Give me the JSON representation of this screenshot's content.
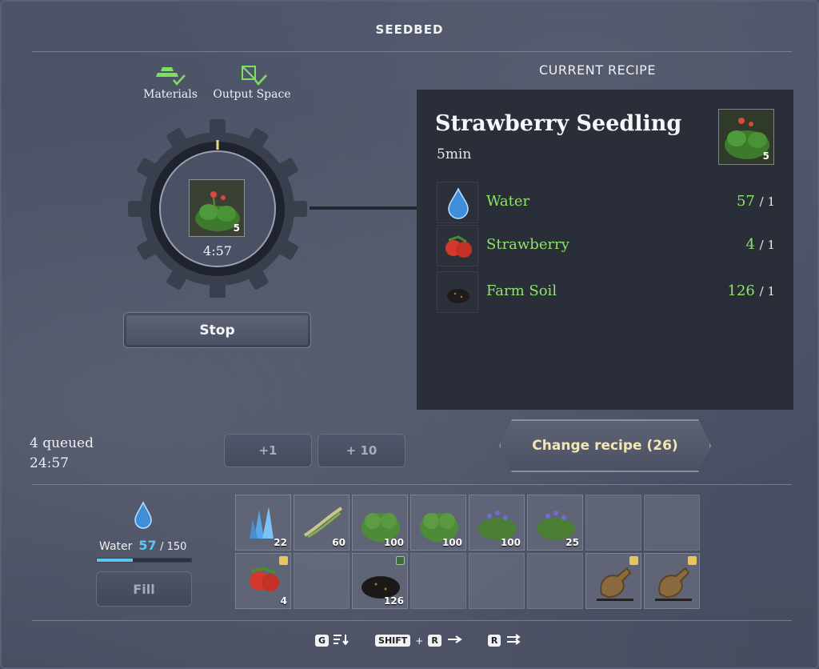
{
  "window": {
    "title": "SEEDBED"
  },
  "status": {
    "materials_label": "Materials",
    "output_label": "Output Space",
    "ok_color": "#7ee061"
  },
  "crafting": {
    "item_count": "5",
    "time_remaining": "4:57",
    "progress": 0.01,
    "stop_label": "Stop"
  },
  "recipe": {
    "header": "CURRENT RECIPE",
    "name": "Strawberry Seedling",
    "duration": "5min",
    "output_count": "5",
    "ingredients": [
      {
        "name": "Water",
        "have": "57",
        "need": "/ 1",
        "icon": "water-drop-icon"
      },
      {
        "name": "Strawberry",
        "have": "4",
        "need": "/ 1",
        "icon": "strawberry-icon"
      },
      {
        "name": "Farm Soil",
        "have": "126",
        "need": "/ 1",
        "icon": "farm-soil-icon"
      }
    ]
  },
  "queue": {
    "count_text": "4 queued",
    "total_time": "24:57",
    "plus1_label": "+1",
    "plus10_label": "+ 10",
    "change_label": "Change recipe (26)"
  },
  "water": {
    "label": "Water",
    "current": "57",
    "max": "/ 150",
    "fill_fraction": 0.38,
    "fill_label": "Fill"
  },
  "inventory": {
    "row1": [
      {
        "icon": "crystal-icon",
        "count": "22"
      },
      {
        "icon": "fiber-icon",
        "count": "60"
      },
      {
        "icon": "shrub-icon",
        "count": "100"
      },
      {
        "icon": "shrub-icon",
        "count": "100"
      },
      {
        "icon": "berry-bush-icon",
        "count": "100"
      },
      {
        "icon": "berry-bush-icon",
        "count": "25"
      },
      {
        "icon": "",
        "count": ""
      },
      {
        "icon": "",
        "count": ""
      }
    ],
    "row2": [
      {
        "icon": "strawberry-icon",
        "count": "4"
      },
      {
        "icon": "",
        "count": ""
      },
      {
        "icon": "farm-soil-icon",
        "count": "126"
      },
      {
        "icon": "",
        "count": ""
      },
      {
        "icon": "",
        "count": ""
      },
      {
        "icon": "",
        "count": ""
      },
      {
        "icon": "fertilizer-sack-icon",
        "count": ""
      },
      {
        "icon": "fertilizer-sack-icon",
        "count": ""
      }
    ]
  },
  "hotkeys": {
    "sort_key": "G",
    "shift_key": "SHIFT",
    "plus": "+",
    "r_key": "R",
    "r_key2": "R"
  }
}
